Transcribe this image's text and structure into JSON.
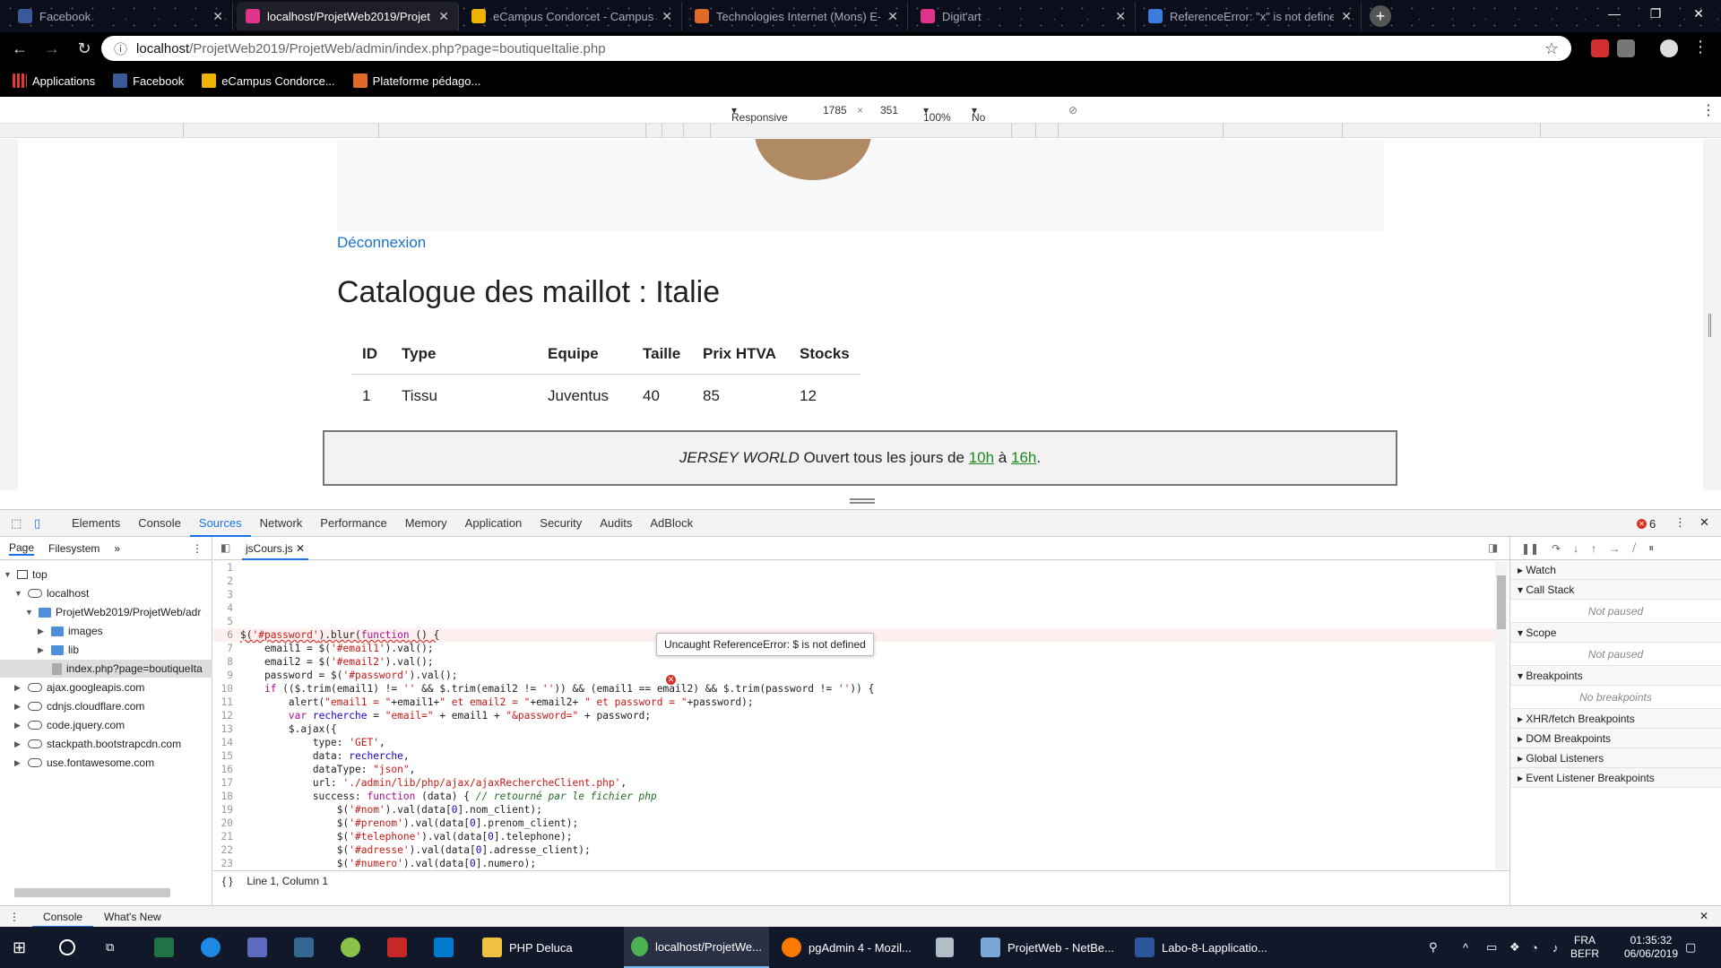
{
  "browser": {
    "tabs": [
      {
        "title": "Facebook",
        "color": "#3b5998"
      },
      {
        "title": "localhost/ProjetWeb2019/Projet...",
        "color": "#e0338c"
      },
      {
        "title": "eCampus Condorcet - Campus N...",
        "color": "#f0b400"
      },
      {
        "title": "Technologies Internet (Mons) E-...",
        "color": "#e06a2a"
      },
      {
        "title": "Digit'art",
        "color": "#e0338c"
      },
      {
        "title": "ReferenceError: \"x\" is not define...",
        "color": "#3b7ddd"
      }
    ],
    "url_host": "localhost",
    "url_path": "/ProjetWeb2019/ProjetWeb/admin/index.php?page=boutiqueItalie.php",
    "bookmarks": [
      {
        "label": "Applications"
      },
      {
        "label": "Facebook"
      },
      {
        "label": "eCampus Condorce..."
      },
      {
        "label": "Plateforme pédago..."
      }
    ]
  },
  "device_bar": {
    "mode": "Responsive",
    "width": "1785",
    "times": "×",
    "height": "351",
    "zoom": "100%",
    "throttle": "No throttling"
  },
  "page": {
    "logout": "Déconnexion",
    "title": "Catalogue des maillot : Italie",
    "table": {
      "headers": [
        "ID",
        "Type",
        "Equipe",
        "Taille",
        "Prix HTVA",
        "Stocks"
      ],
      "rows": [
        [
          "1",
          "Tissu",
          "Juventus",
          "40",
          "85",
          "12"
        ]
      ]
    },
    "footer": {
      "brand": "JERSEY WORLD",
      "text1": " Ouvert tous les jours de ",
      "from": "10h",
      "text2": " à ",
      "to": "16h",
      "end": "."
    }
  },
  "devtools": {
    "tabs": [
      "Elements",
      "Console",
      "Sources",
      "Network",
      "Performance",
      "Memory",
      "Application",
      "Security",
      "Audits",
      "AdBlock"
    ],
    "error_count": "6",
    "nav_tabs": [
      "Page",
      "Filesystem"
    ],
    "tree": [
      {
        "label": "top"
      },
      {
        "label": "localhost"
      },
      {
        "label": "ProjetWeb2019/ProjetWeb/adr"
      },
      {
        "label": "images"
      },
      {
        "label": "lib"
      },
      {
        "label": "index.php?page=boutiqueIta"
      },
      {
        "label": "ajax.googleapis.com"
      },
      {
        "label": "cdnjs.cloudflare.com"
      },
      {
        "label": "code.jquery.com"
      },
      {
        "label": "stackpath.bootstrapcdn.com"
      },
      {
        "label": "use.fontawesome.com"
      }
    ],
    "open_file": "jsCours.js",
    "error_tooltip": "Uncaught ReferenceError: $ is not defined",
    "status": "Line 1, Column 1",
    "debugger": {
      "watch": "Watch",
      "call_stack": "Call Stack",
      "not_paused": "Not paused",
      "scope": "Scope",
      "breakpoints": "Breakpoints",
      "no_breakpoints": "No breakpoints",
      "xhr": "XHR/fetch Breakpoints",
      "dom": "DOM Breakpoints",
      "global": "Global Listeners",
      "event": "Event Listener Breakpoints"
    },
    "drawer_tabs": [
      "Console",
      "What's New"
    ]
  },
  "taskbar": {
    "tasks": [
      {
        "label": "PHP Deluca",
        "color": "#f0c040"
      },
      {
        "label": "localhost/ProjetWe...",
        "color": "#4caf50"
      },
      {
        "label": "pgAdmin 4 - Mozil...",
        "color": "#ff7a00"
      },
      {
        "label": "ProjetWeb - NetBe...",
        "color": "#7aa7d8"
      },
      {
        "label": "Labo-8-Lapplicatio...",
        "color": "#2b579a"
      }
    ],
    "lang1": "FRA",
    "lang2": "BEFR",
    "time": "01:35:32",
    "date": "06/06/2019"
  }
}
